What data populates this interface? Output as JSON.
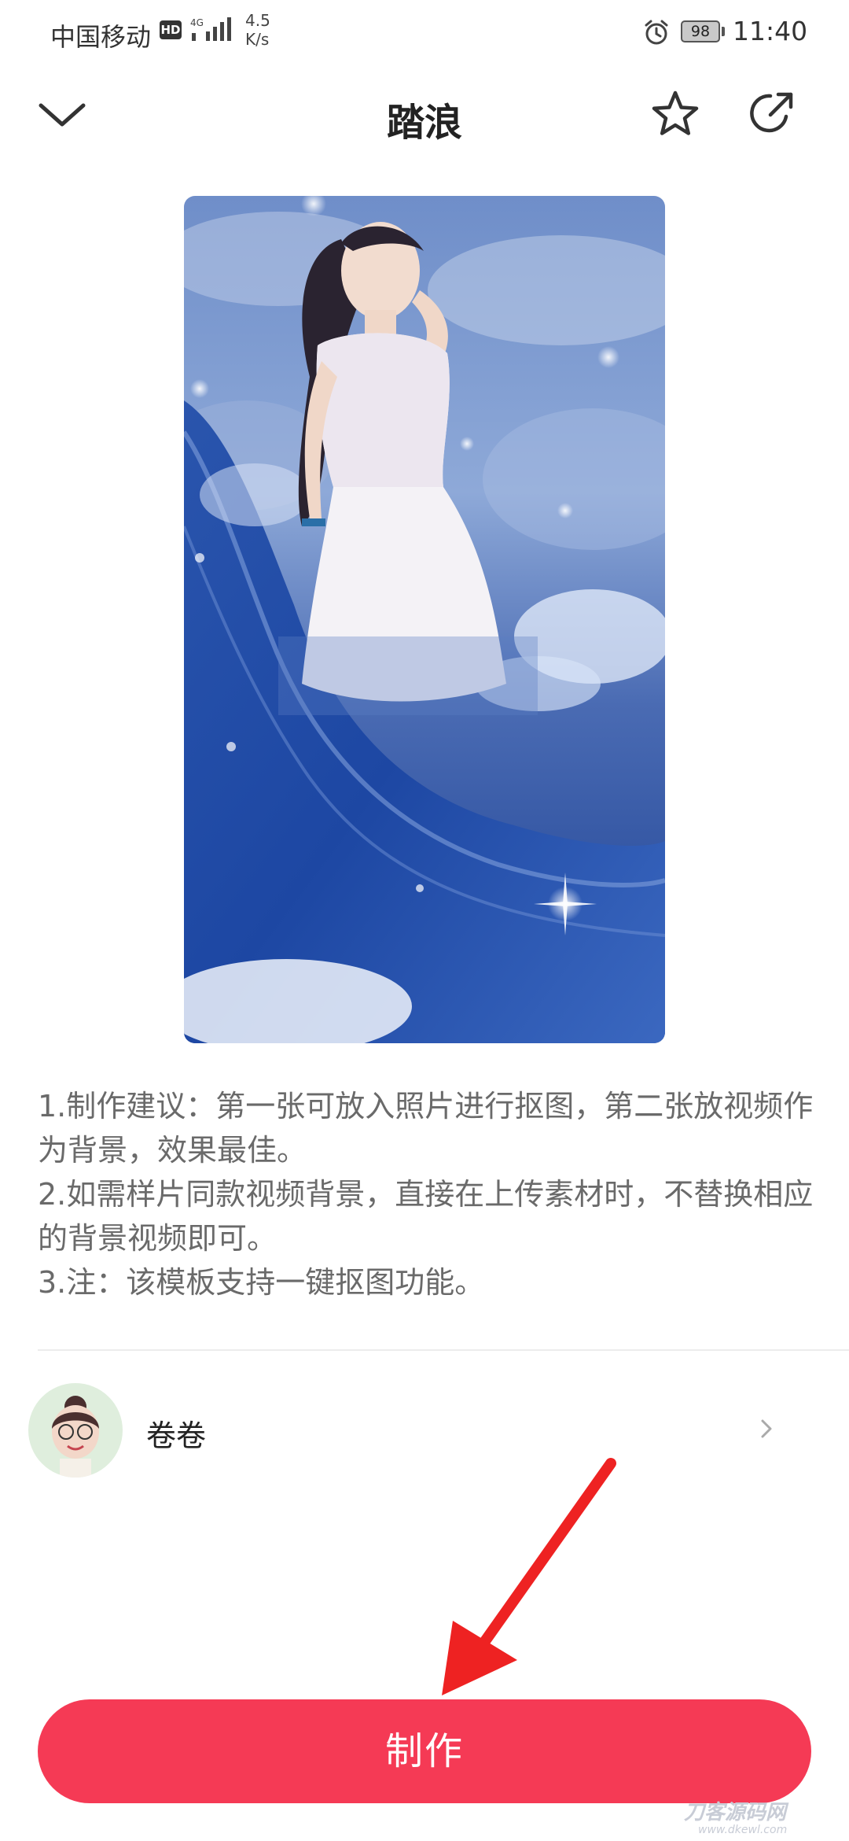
{
  "status_bar": {
    "carrier": "中国移动",
    "hd_badge": "HD",
    "network": "4G",
    "speed_value": "4.5",
    "speed_unit": "K/s",
    "battery": "98",
    "time": "11:40",
    "icons": [
      "signal-icon",
      "alarm-icon",
      "battery-icon"
    ]
  },
  "header": {
    "title": "踏浪",
    "icons": [
      "chevron-down-icon",
      "star-icon",
      "share-icon"
    ]
  },
  "description": {
    "lines": [
      "1.制作建议：第一张可放入照片进行抠图，第二张放视频作为背景，效果最佳。",
      "2.如需样片同款视频背景，直接在上传素材时，不替换相应的背景视频即可。",
      "3.注：该模板支持一键抠图功能。"
    ]
  },
  "author": {
    "name": "卷卷"
  },
  "action": {
    "make_label": "制作"
  },
  "colors": {
    "accent": "#f53a55",
    "annotation_arrow": "#ee2222",
    "description_text": "#6a6a6a"
  }
}
